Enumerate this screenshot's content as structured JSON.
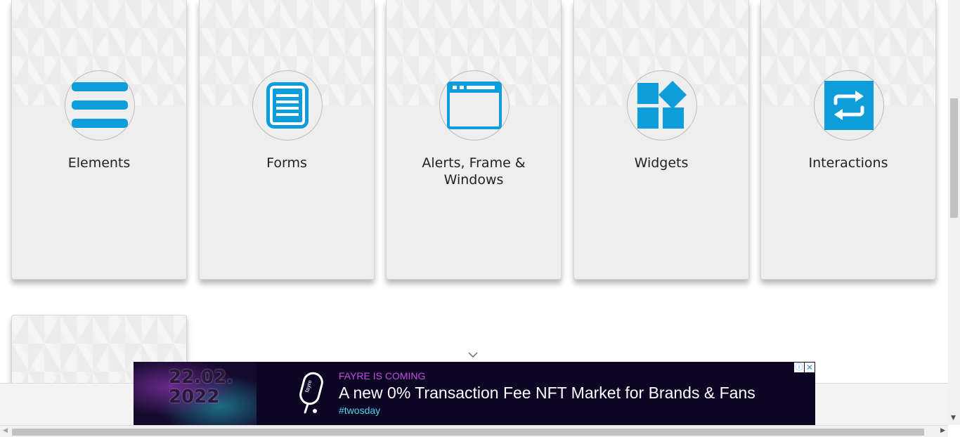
{
  "accent_color": "#0e9ddb",
  "cards": [
    {
      "title": "Elements",
      "icon": "hamburger-icon"
    },
    {
      "title": "Forms",
      "icon": "document-icon"
    },
    {
      "title": "Alerts, Frame & Windows",
      "icon": "browser-window-icon"
    },
    {
      "title": "Widgets",
      "icon": "widgets-icon"
    },
    {
      "title": "Interactions",
      "icon": "repeat-icon"
    }
  ],
  "ad": {
    "art_text": "22.02.2022",
    "logo_text": "fayre",
    "kicker": "FAYRE IS COMING",
    "headline": "A new 0% Transaction Fee NFT Market for Brands & Fans",
    "hashtag": "#twosday",
    "info_icon": "info-icon",
    "close_icon": "close-icon"
  }
}
